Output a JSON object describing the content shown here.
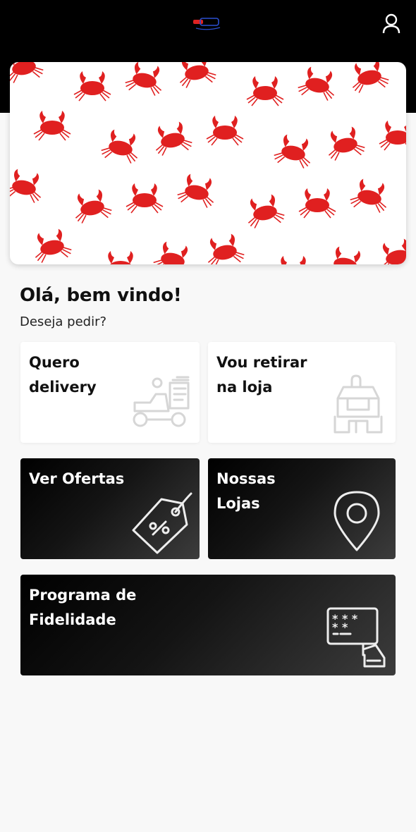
{
  "header": {
    "logo_icon": "brand-logo-icon",
    "user_icon": "user-icon",
    "background": "#000000"
  },
  "banner": {
    "pattern_icon": "crab-icon",
    "pattern_color": "#e02020"
  },
  "greeting": {
    "title": "Olá, bem vindo!",
    "subtitle": "Deseja pedir?"
  },
  "cards": {
    "delivery": {
      "label": "Quero\ndelivery",
      "icon": "delivery-scooter-icon"
    },
    "pickup": {
      "label": "Vou retirar\nna loja",
      "icon": "store-pickup-icon"
    },
    "offers": {
      "label": "Ver Ofertas",
      "icon": "discount-tag-icon"
    },
    "stores": {
      "label": "Nossas\nLojas",
      "icon": "map-pin-icon"
    },
    "loyalty": {
      "label": "Programa de\nFidelidade",
      "icon": "loyalty-card-icon"
    }
  }
}
